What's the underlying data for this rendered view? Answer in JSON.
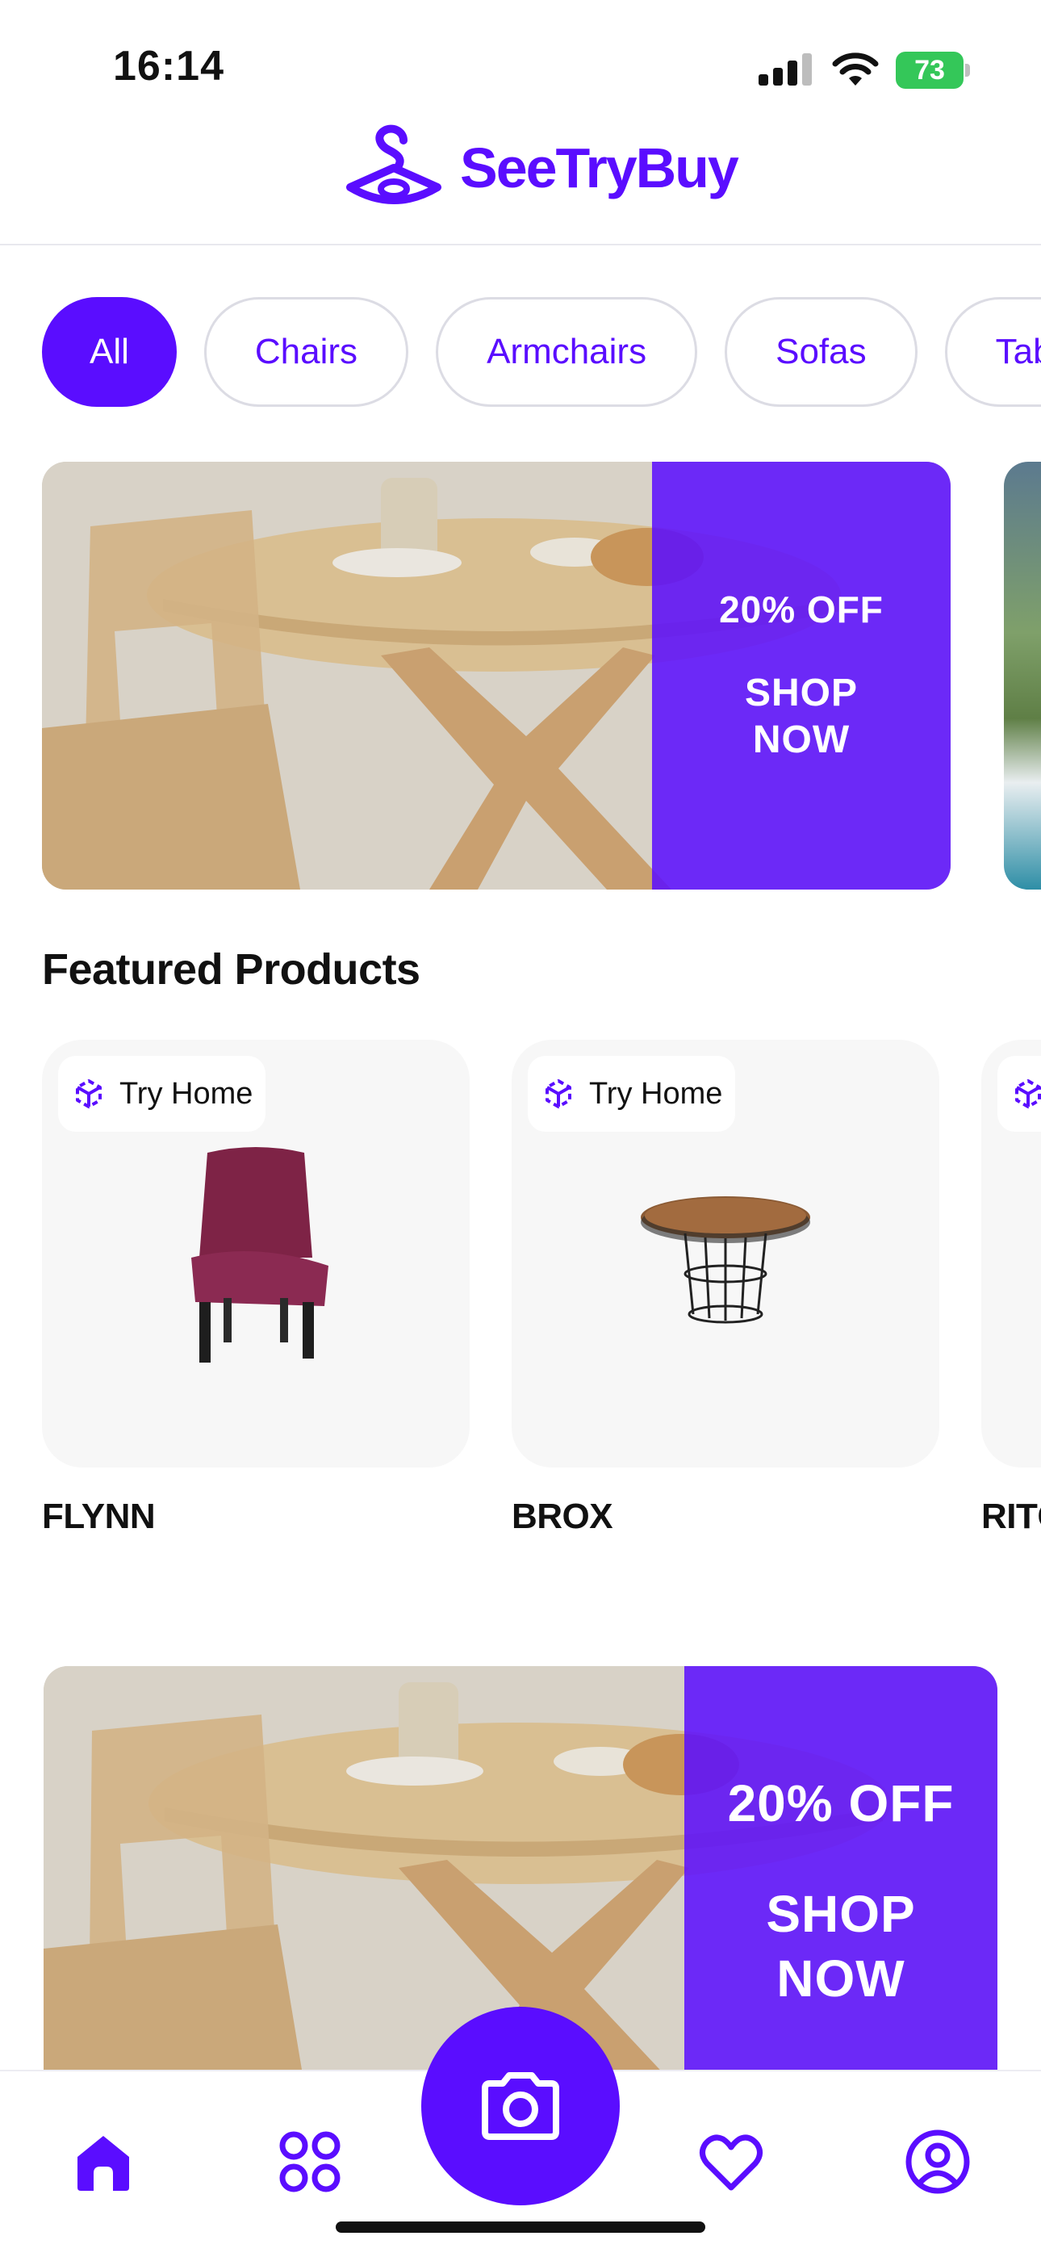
{
  "status_bar": {
    "time": "16:14",
    "battery": "73"
  },
  "header": {
    "logo_text": "SeeTryBuy"
  },
  "categories": [
    {
      "label": "All",
      "active": true
    },
    {
      "label": "Chairs",
      "active": false
    },
    {
      "label": "Armchairs",
      "active": false
    },
    {
      "label": "Sofas",
      "active": false
    },
    {
      "label": "Tab",
      "active": false
    }
  ],
  "promo_banner": {
    "discount": "20% OFF",
    "cta_line1": "SHOP",
    "cta_line2": "NOW"
  },
  "featured": {
    "title": "Featured Products",
    "try_label": "Try Home",
    "products": [
      {
        "name": "FLYNN"
      },
      {
        "name": "BROX"
      },
      {
        "name": "RITC"
      }
    ]
  },
  "tab_bar": {
    "icons": [
      "home-icon",
      "categories-icon",
      "camera-icon",
      "heart-icon",
      "profile-icon"
    ]
  },
  "colors": {
    "accent": "#5a0dff",
    "chip_border": "#dcdce4",
    "card_bg": "#f7f7f7"
  }
}
